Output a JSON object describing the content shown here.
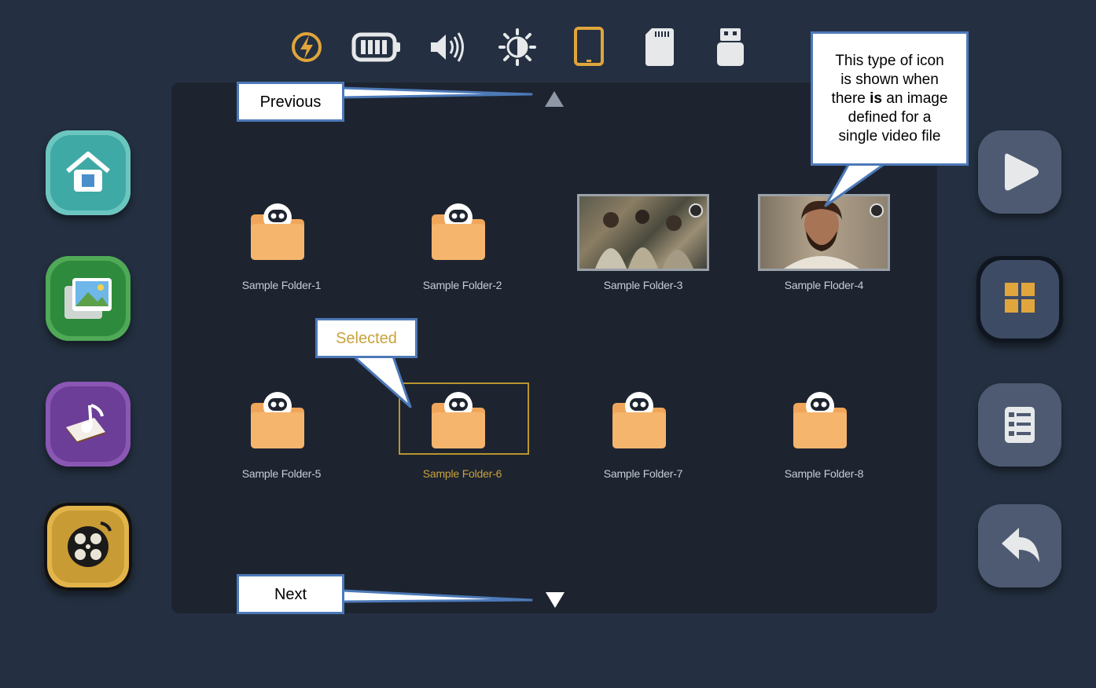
{
  "status_bar": {
    "icons": [
      "power-icon",
      "battery-icon",
      "volume-icon",
      "brightness-icon",
      "tablet-icon",
      "sd-card-icon",
      "usb-icon"
    ]
  },
  "left_nav": [
    "home-icon",
    "photos-icon",
    "music-icon",
    "video-reel-icon"
  ],
  "right_nav": [
    "play-icon",
    "grid-view-icon",
    "list-view-icon",
    "back-icon"
  ],
  "grid": {
    "items": [
      {
        "label": "Sample Folder-1",
        "type": "folder"
      },
      {
        "label": "Sample Folder-2",
        "type": "folder"
      },
      {
        "label": "Sample Folder-3",
        "type": "image"
      },
      {
        "label": "Sample Floder-4",
        "type": "image"
      },
      {
        "label": "Sample Folder-5",
        "type": "folder"
      },
      {
        "label": "Sample Folder-6",
        "type": "folder",
        "selected": true
      },
      {
        "label": "Sample Folder-7",
        "type": "folder"
      },
      {
        "label": "Sample Folder-8",
        "type": "folder"
      }
    ]
  },
  "callouts": {
    "previous": "Previous",
    "next": "Next",
    "selected": "Selected",
    "image_note": {
      "line1": "This type of icon",
      "line2": "is shown when",
      "line3_a": "there ",
      "line3_bold": "is",
      "line3_b": " an image",
      "line4": "defined for a",
      "line5": "single video file"
    }
  },
  "colors": {
    "background": "#243041",
    "panel": "#1d2430",
    "accent": "#c9a23b",
    "folder": "#f0a65a",
    "callout_border": "#4d79b8"
  }
}
